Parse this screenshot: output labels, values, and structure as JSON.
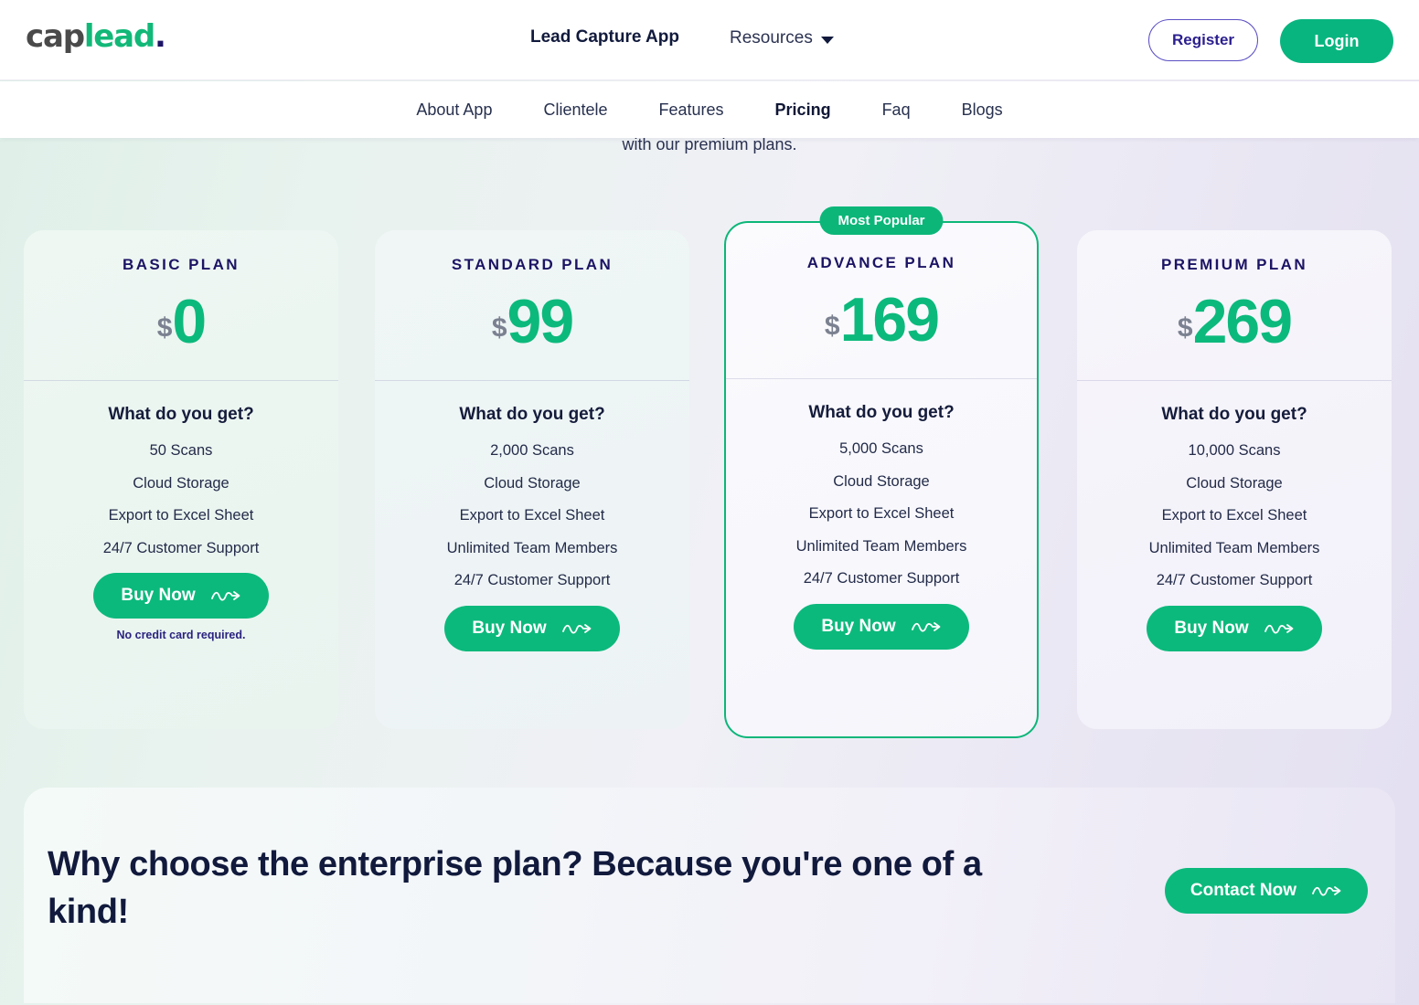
{
  "header": {
    "logo": {
      "part1": "cap",
      "part2": "lead",
      "part3": "."
    },
    "brand_link": "Lead Capture App",
    "resources": "Resources",
    "register": "Register",
    "login": "Login"
  },
  "subnav": {
    "items": [
      {
        "label": "About App",
        "active": false
      },
      {
        "label": "Clientele",
        "active": false
      },
      {
        "label": "Features",
        "active": false
      },
      {
        "label": "Pricing",
        "active": true
      },
      {
        "label": "Faq",
        "active": false
      },
      {
        "label": "Blogs",
        "active": false
      }
    ]
  },
  "hero": {
    "subtitle_visible": "with our premium plans."
  },
  "pricing": {
    "get_title": "What do you get?",
    "buy_label": "Buy Now",
    "plans": [
      {
        "name": "BASIC PLAN",
        "currency": "$",
        "amount": "0",
        "features": [
          "50 Scans",
          "Cloud Storage",
          "Export to Excel Sheet",
          "24/7 Customer Support"
        ],
        "note": "No credit card required.",
        "badge": null
      },
      {
        "name": "STANDARD PLAN",
        "currency": "$",
        "amount": "99",
        "features": [
          "2,000 Scans",
          "Cloud Storage",
          "Export to Excel Sheet",
          "Unlimited Team Members",
          "24/7 Customer Support"
        ],
        "note": null,
        "badge": null
      },
      {
        "name": "ADVANCE PLAN",
        "currency": "$",
        "amount": "169",
        "features": [
          "5,000 Scans",
          "Cloud Storage",
          "Export to Excel Sheet",
          "Unlimited Team Members",
          "24/7 Customer Support"
        ],
        "note": null,
        "badge": "Most Popular"
      },
      {
        "name": "PREMIUM PLAN",
        "currency": "$",
        "amount": "269",
        "features": [
          "10,000 Scans",
          "Cloud Storage",
          "Export to Excel Sheet",
          "Unlimited Team Members",
          "24/7 Customer Support"
        ],
        "note": null,
        "badge": null
      }
    ]
  },
  "enterprise": {
    "title": "Why choose the enterprise plan? Because you're one of a kind!",
    "cta": "Contact Now"
  },
  "colors": {
    "green": "#0cb97c",
    "navy": "#111a3c",
    "indigo": "#1c1464",
    "purple_outline": "#5b4fc4",
    "dollar_gray": "#7b8190"
  }
}
